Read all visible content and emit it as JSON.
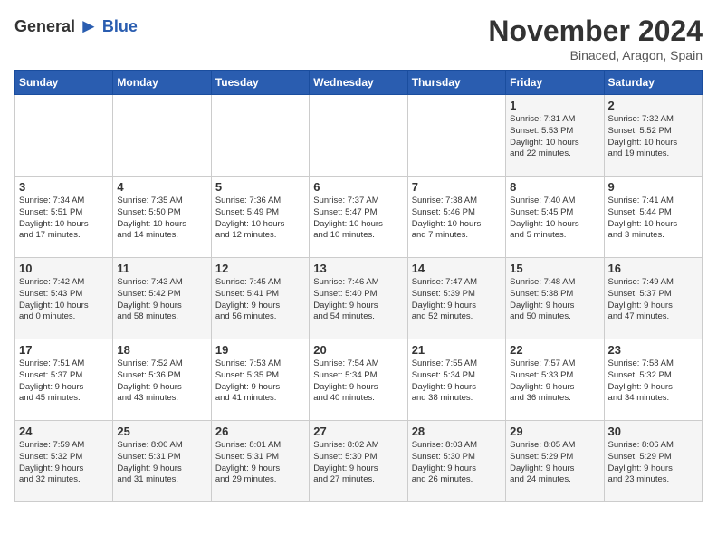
{
  "header": {
    "logo_general": "General",
    "logo_blue": "Blue",
    "title": "November 2024",
    "location": "Binaced, Aragon, Spain"
  },
  "weekdays": [
    "Sunday",
    "Monday",
    "Tuesday",
    "Wednesday",
    "Thursday",
    "Friday",
    "Saturday"
  ],
  "weeks": [
    [
      {
        "day": "",
        "info": ""
      },
      {
        "day": "",
        "info": ""
      },
      {
        "day": "",
        "info": ""
      },
      {
        "day": "",
        "info": ""
      },
      {
        "day": "",
        "info": ""
      },
      {
        "day": "1",
        "info": "Sunrise: 7:31 AM\nSunset: 5:53 PM\nDaylight: 10 hours\nand 22 minutes."
      },
      {
        "day": "2",
        "info": "Sunrise: 7:32 AM\nSunset: 5:52 PM\nDaylight: 10 hours\nand 19 minutes."
      }
    ],
    [
      {
        "day": "3",
        "info": "Sunrise: 7:34 AM\nSunset: 5:51 PM\nDaylight: 10 hours\nand 17 minutes."
      },
      {
        "day": "4",
        "info": "Sunrise: 7:35 AM\nSunset: 5:50 PM\nDaylight: 10 hours\nand 14 minutes."
      },
      {
        "day": "5",
        "info": "Sunrise: 7:36 AM\nSunset: 5:49 PM\nDaylight: 10 hours\nand 12 minutes."
      },
      {
        "day": "6",
        "info": "Sunrise: 7:37 AM\nSunset: 5:47 PM\nDaylight: 10 hours\nand 10 minutes."
      },
      {
        "day": "7",
        "info": "Sunrise: 7:38 AM\nSunset: 5:46 PM\nDaylight: 10 hours\nand 7 minutes."
      },
      {
        "day": "8",
        "info": "Sunrise: 7:40 AM\nSunset: 5:45 PM\nDaylight: 10 hours\nand 5 minutes."
      },
      {
        "day": "9",
        "info": "Sunrise: 7:41 AM\nSunset: 5:44 PM\nDaylight: 10 hours\nand 3 minutes."
      }
    ],
    [
      {
        "day": "10",
        "info": "Sunrise: 7:42 AM\nSunset: 5:43 PM\nDaylight: 10 hours\nand 0 minutes."
      },
      {
        "day": "11",
        "info": "Sunrise: 7:43 AM\nSunset: 5:42 PM\nDaylight: 9 hours\nand 58 minutes."
      },
      {
        "day": "12",
        "info": "Sunrise: 7:45 AM\nSunset: 5:41 PM\nDaylight: 9 hours\nand 56 minutes."
      },
      {
        "day": "13",
        "info": "Sunrise: 7:46 AM\nSunset: 5:40 PM\nDaylight: 9 hours\nand 54 minutes."
      },
      {
        "day": "14",
        "info": "Sunrise: 7:47 AM\nSunset: 5:39 PM\nDaylight: 9 hours\nand 52 minutes."
      },
      {
        "day": "15",
        "info": "Sunrise: 7:48 AM\nSunset: 5:38 PM\nDaylight: 9 hours\nand 50 minutes."
      },
      {
        "day": "16",
        "info": "Sunrise: 7:49 AM\nSunset: 5:37 PM\nDaylight: 9 hours\nand 47 minutes."
      }
    ],
    [
      {
        "day": "17",
        "info": "Sunrise: 7:51 AM\nSunset: 5:37 PM\nDaylight: 9 hours\nand 45 minutes."
      },
      {
        "day": "18",
        "info": "Sunrise: 7:52 AM\nSunset: 5:36 PM\nDaylight: 9 hours\nand 43 minutes."
      },
      {
        "day": "19",
        "info": "Sunrise: 7:53 AM\nSunset: 5:35 PM\nDaylight: 9 hours\nand 41 minutes."
      },
      {
        "day": "20",
        "info": "Sunrise: 7:54 AM\nSunset: 5:34 PM\nDaylight: 9 hours\nand 40 minutes."
      },
      {
        "day": "21",
        "info": "Sunrise: 7:55 AM\nSunset: 5:34 PM\nDaylight: 9 hours\nand 38 minutes."
      },
      {
        "day": "22",
        "info": "Sunrise: 7:57 AM\nSunset: 5:33 PM\nDaylight: 9 hours\nand 36 minutes."
      },
      {
        "day": "23",
        "info": "Sunrise: 7:58 AM\nSunset: 5:32 PM\nDaylight: 9 hours\nand 34 minutes."
      }
    ],
    [
      {
        "day": "24",
        "info": "Sunrise: 7:59 AM\nSunset: 5:32 PM\nDaylight: 9 hours\nand 32 minutes."
      },
      {
        "day": "25",
        "info": "Sunrise: 8:00 AM\nSunset: 5:31 PM\nDaylight: 9 hours\nand 31 minutes."
      },
      {
        "day": "26",
        "info": "Sunrise: 8:01 AM\nSunset: 5:31 PM\nDaylight: 9 hours\nand 29 minutes."
      },
      {
        "day": "27",
        "info": "Sunrise: 8:02 AM\nSunset: 5:30 PM\nDaylight: 9 hours\nand 27 minutes."
      },
      {
        "day": "28",
        "info": "Sunrise: 8:03 AM\nSunset: 5:30 PM\nDaylight: 9 hours\nand 26 minutes."
      },
      {
        "day": "29",
        "info": "Sunrise: 8:05 AM\nSunset: 5:29 PM\nDaylight: 9 hours\nand 24 minutes."
      },
      {
        "day": "30",
        "info": "Sunrise: 8:06 AM\nSunset: 5:29 PM\nDaylight: 9 hours\nand 23 minutes."
      }
    ]
  ]
}
